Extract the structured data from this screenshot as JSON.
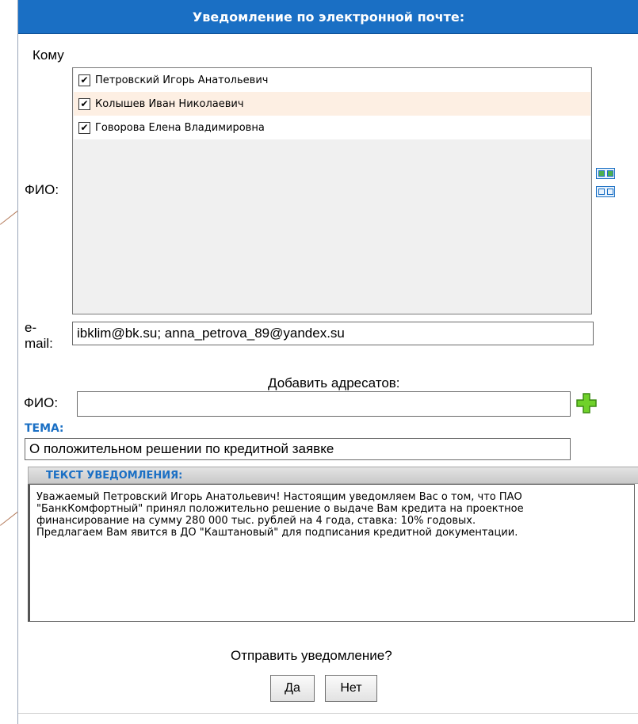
{
  "dialog": {
    "title": "Уведомление по электронной почте:",
    "to_label": "Кому",
    "fio_label": "ФИО:",
    "email_label": "e-mail:",
    "add_recipients_label": "Добавить адресатов:",
    "add_fio_label": "ФИО:",
    "subject_label": "ТЕМА:",
    "text_label": "ТЕКСТ УВЕДОМЛЕНИЯ:",
    "send_question": "Отправить уведомление?",
    "yes_button": "Да",
    "no_button": "Нет"
  },
  "recipients": [
    {
      "name": "Петровский Игорь Анатольевич",
      "checked": true
    },
    {
      "name": "Колышев Иван Николаевич",
      "checked": true
    },
    {
      "name": "Говорова Елена Владимировна",
      "checked": true
    }
  ],
  "fields": {
    "email_value": "ibklim@bk.su; anna_petrova_89@yandex.su",
    "add_fio_value": "",
    "subject_value": "О положительном решении по кредитной заявке",
    "text_value": "Уважаемый Петровский Игорь Анатольевич! Настоящим уведомляем Вас о том, что ПАО\n\"БанкКомфортный\" принял положительно решение о выдаче Вам кредита на проектное\nфинансирование на сумму 280 000 тыс. рублей на 4 года, ставка: 10% годовых.\nПредлагаем Вам явится в ДО \"Каштановый\" для подписания кредитной документации."
  },
  "icons": {
    "select_all": "select-all-icon",
    "deselect_all": "deselect-all-icon",
    "add": "plus-icon",
    "checkbox_mark": "✔"
  },
  "colors": {
    "title_bar": "#1a6fc4",
    "highlight_row": "#fdefe3",
    "add_icon": "#5cc21b",
    "label_blue": "#1a6fc4"
  }
}
